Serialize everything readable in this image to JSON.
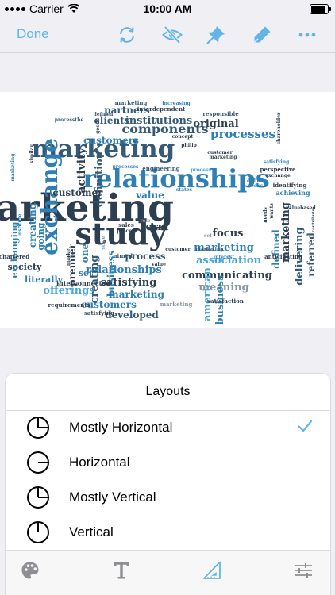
{
  "status_bar": {
    "carrier": "Carrier",
    "time": "10:00 AM",
    "battery_level": 1.0
  },
  "toolbar": {
    "done_label": "Done",
    "icons": [
      "refresh-icon",
      "eye-slash-icon",
      "pin-icon",
      "pen-icon",
      "more-icon"
    ]
  },
  "word_cloud": {
    "colors": {
      "dark": "#2d3e50",
      "mid": "#355a78",
      "blue": "#2e7fb4",
      "light": "#4aa7db",
      "gray": "#8896a3"
    },
    "words": [
      {
        "t": "marketing",
        "c": "dark"
      },
      {
        "t": "study",
        "c": "dark"
      },
      {
        "t": "relationships",
        "c": "blue"
      },
      {
        "t": "marketing",
        "c": "mid"
      },
      {
        "t": "exchange",
        "c": "blue"
      },
      {
        "t": "components",
        "c": "mid"
      },
      {
        "t": "processes",
        "c": "blue"
      },
      {
        "t": "institutions",
        "c": "mid"
      },
      {
        "t": "partners",
        "c": "mid"
      },
      {
        "t": "clients",
        "c": "mid"
      },
      {
        "t": "original",
        "c": "dark"
      },
      {
        "t": "customers",
        "c": "blue"
      },
      {
        "t": "definition",
        "c": "mid"
      },
      {
        "t": "activity",
        "c": "dark"
      },
      {
        "t": "customer",
        "c": "dark"
      },
      {
        "t": "value",
        "c": "blue"
      },
      {
        "t": "association",
        "c": "light"
      },
      {
        "t": "focus",
        "c": "dark"
      },
      {
        "t": "marketing",
        "c": "blue"
      },
      {
        "t": "communicating",
        "c": "dark"
      },
      {
        "t": "meaning",
        "c": "gray"
      },
      {
        "t": "process",
        "c": "mid"
      },
      {
        "t": "term",
        "c": "dark"
      },
      {
        "t": "relationships",
        "c": "blue"
      },
      {
        "t": "satisfying",
        "c": "dark"
      },
      {
        "t": "marketing",
        "c": "blue"
      },
      {
        "t": "offerings",
        "c": "light"
      },
      {
        "t": "customers",
        "c": "blue"
      },
      {
        "t": "developed",
        "c": "mid"
      },
      {
        "t": "literally",
        "c": "blue"
      },
      {
        "t": "society",
        "c": "dark"
      },
      {
        "t": "premier",
        "c": "dark"
      },
      {
        "t": "creating",
        "c": "mid"
      },
      {
        "t": "business",
        "c": "blue"
      },
      {
        "t": "american",
        "c": "light"
      },
      {
        "t": "business",
        "c": "blue"
      },
      {
        "t": "delivering",
        "c": "mid"
      },
      {
        "t": "referred",
        "c": "mid"
      },
      {
        "t": "defined",
        "c": "blue"
      },
      {
        "t": "marketing",
        "c": "dark"
      },
      {
        "t": "exchanging",
        "c": "blue"
      },
      {
        "t": "creating",
        "c": "blue"
      },
      {
        "t": "going",
        "c": "blue"
      },
      {
        "t": "one",
        "c": "blue"
      },
      {
        "t": "set",
        "c": "blue"
      },
      {
        "t": "interconnected",
        "c": "dark"
      },
      {
        "t": "requirements",
        "c": "dark"
      },
      {
        "t": "satisfying",
        "c": "dark"
      },
      {
        "t": "satisfaction",
        "c": "dark"
      },
      {
        "t": "marketing",
        "c": "gray"
      },
      {
        "t": "chartered",
        "c": "dark"
      },
      {
        "t": "anticipating",
        "c": "dark"
      },
      {
        "t": "achieving",
        "c": "blue"
      },
      {
        "t": "perspective",
        "c": "dark"
      },
      {
        "t": "exchange",
        "c": "dark"
      },
      {
        "t": "identifying",
        "c": "dark"
      },
      {
        "t": "satisfying",
        "c": "blue"
      },
      {
        "t": "shareholder",
        "c": "dark"
      },
      {
        "t": "interdependent",
        "c": "dark"
      },
      {
        "t": "responsible",
        "c": "mid"
      },
      {
        "t": "marketing",
        "c": "mid"
      },
      {
        "t": "increasing",
        "c": "blue"
      },
      {
        "t": "engineering",
        "c": "mid"
      },
      {
        "t": "processes",
        "c": "blue"
      },
      {
        "t": "process",
        "c": "light"
      },
      {
        "t": "concept",
        "c": "dark"
      },
      {
        "t": "philip",
        "c": "dark"
      },
      {
        "t": "marketing",
        "c": "dark"
      },
      {
        "t": "customer",
        "c": "dark"
      },
      {
        "t": "interest",
        "c": "blue"
      },
      {
        "t": "sales",
        "c": "dark"
      },
      {
        "t": "aimed",
        "c": "mid"
      },
      {
        "t": "states",
        "c": "blue"
      },
      {
        "t": "similar",
        "c": "dark"
      },
      {
        "t": "institute",
        "c": "blue"
      },
      {
        "t": "market",
        "c": "dark"
      },
      {
        "t": "defines",
        "c": "blue"
      },
      {
        "t": "seeks",
        "c": "blue"
      },
      {
        "t": "needs",
        "c": "dark"
      },
      {
        "t": "wants",
        "c": "dark"
      },
      {
        "t": "valuebased",
        "c": "dark"
      },
      {
        "t": "contribute",
        "c": "dark"
      },
      {
        "t": "marketing",
        "c": "blue"
      },
      {
        "t": "processthe",
        "c": "mid"
      },
      {
        "t": "defined",
        "c": "mid"
      },
      {
        "t": "goods",
        "c": "dark"
      },
      {
        "t": "role",
        "c": "gray"
      },
      {
        "t": "scale",
        "c": "gray"
      },
      {
        "t": "process",
        "c": "dark"
      },
      {
        "t": "set",
        "c": "gray"
      },
      {
        "t": "value",
        "c": "dark"
      },
      {
        "t": "customer",
        "c": "dark"
      },
      {
        "t": "marketing",
        "c": "mid"
      }
    ]
  },
  "layouts_sheet": {
    "title": "Layouts",
    "options": [
      {
        "label": "Mostly Horizontal",
        "icon": "pie-mostly-horizontal-icon",
        "selected": true
      },
      {
        "label": "Horizontal",
        "icon": "pie-horizontal-icon",
        "selected": false
      },
      {
        "label": "Mostly Vertical",
        "icon": "pie-mostly-vertical-icon",
        "selected": false
      },
      {
        "label": "Vertical",
        "icon": "pie-vertical-icon",
        "selected": false
      }
    ],
    "check_color": "#63b5e6"
  },
  "bottom_toolbar": {
    "icons": [
      "palette-icon",
      "text-icon",
      "layout-triangle-icon",
      "settings-sliders-icon"
    ],
    "active": "layout-triangle-icon"
  }
}
